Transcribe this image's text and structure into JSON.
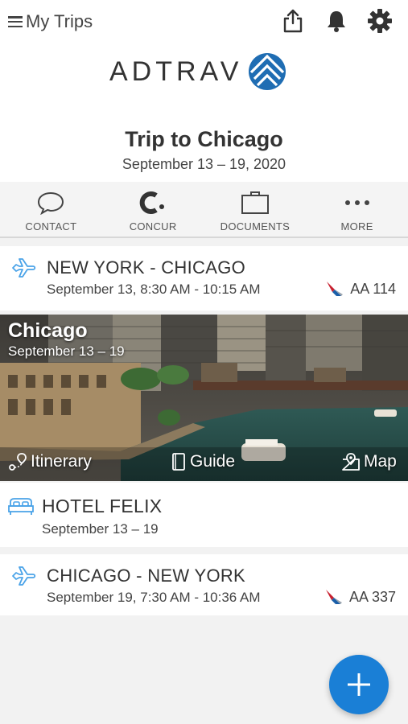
{
  "topbar": {
    "title": "My Trips",
    "icons": [
      "menu-icon",
      "share-icon",
      "bell-icon",
      "gear-icon"
    ]
  },
  "brand": {
    "logo_text": "ADTRAV"
  },
  "trip": {
    "title": "Trip to Chicago",
    "dates": "September 13 – 19, 2020"
  },
  "actions": [
    {
      "label": "CONTACT",
      "icon": "chat-bubble-icon"
    },
    {
      "label": "CONCUR",
      "icon": "concur-icon"
    },
    {
      "label": "DOCUMENTS",
      "icon": "briefcase-icon"
    },
    {
      "label": "MORE",
      "icon": "more-dots-icon"
    }
  ],
  "segments": {
    "flight1": {
      "route": "NEW YORK - CHICAGO",
      "time": "September 13, 8:30 AM - 10:15 AM",
      "flight": "AA 114"
    },
    "city": {
      "name": "Chicago",
      "dates": "September 13 – 19",
      "links": {
        "itinerary": "Itinerary",
        "guide": "Guide",
        "map": "Map"
      }
    },
    "hotel": {
      "name": "HOTEL FELIX",
      "dates": "September 13 – 19"
    },
    "flight2": {
      "route": "CHICAGO - NEW YORK",
      "time": "September 19, 7:30 AM - 10:36 AM",
      "flight": "AA 337"
    }
  },
  "colors": {
    "accent": "#1a7fd6",
    "icon_blue": "#4aa3e8",
    "background": "#f2f2f2",
    "text": "#333333"
  }
}
